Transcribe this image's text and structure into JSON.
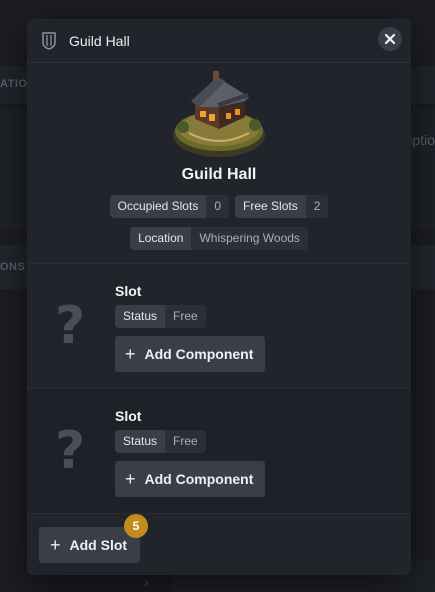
{
  "background": {
    "section_label_1": "ATIO",
    "section_label_2": "ONS",
    "card_text": "iptio"
  },
  "modal": {
    "title": "Guild Hall",
    "header_icon": "shield-icon",
    "close_icon": "close-icon",
    "building": {
      "image": "guild-hall-building-illustration",
      "name": "Guild Hall",
      "stats": [
        {
          "label": "Occupied Slots",
          "value": "0"
        },
        {
          "label": "Free Slots",
          "value": "2"
        }
      ],
      "location": {
        "label": "Location",
        "value": "Whispering Woods"
      }
    },
    "slots": [
      {
        "icon": "question-mark-icon",
        "title": "Slot",
        "status_label": "Status",
        "status_value": "Free",
        "add_component_label": "Add Component"
      },
      {
        "icon": "question-mark-icon",
        "title": "Slot",
        "status_label": "Status",
        "status_value": "Free",
        "add_component_label": "Add Component"
      }
    ],
    "add_slot_label": "Add Slot",
    "add_slot_badge": "5"
  },
  "colors": {
    "accent_badge": "#c48a1e",
    "modal_bg": "#21242b",
    "button_bg": "#3a3e48"
  }
}
